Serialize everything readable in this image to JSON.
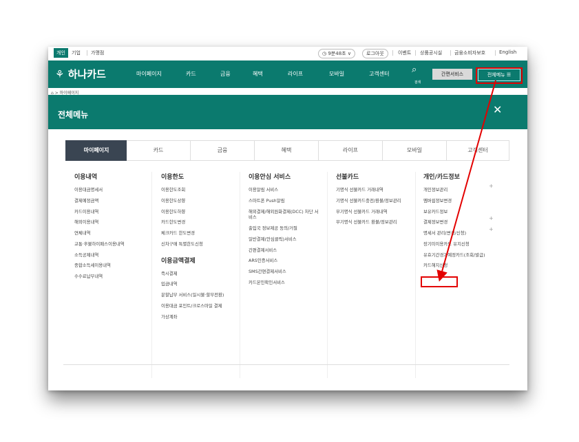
{
  "util": {
    "segments": [
      "개인",
      "기업",
      "가맹점"
    ],
    "timer": "9분48초",
    "logout": "로그아웃",
    "links": [
      "이벤트",
      "상품공시실",
      "금융소비자보호",
      "English"
    ]
  },
  "gnb": {
    "logo": "하나카드",
    "menus": [
      "마이페이지",
      "카드",
      "금융",
      "혜택",
      "라이프",
      "모바일",
      "고객센터"
    ],
    "bell_label": "검색",
    "simple_service": "간편서비스",
    "all_menu": "전체메뉴 ☰"
  },
  "breadcrumb": "⌂ > 마이페이지",
  "panel": {
    "title": "전체메뉴",
    "close": "✕"
  },
  "tabs": [
    "마이페이지",
    "카드",
    "금융",
    "혜택",
    "라이프",
    "모바일",
    "고객센터"
  ],
  "columns": {
    "c1": {
      "head": "이용내역",
      "items": [
        "이용대금명세서",
        "결제예정금액",
        "카드이용내역",
        "해외이용내역",
        "연체내역",
        "교통·후불하이패스이용내역",
        "소득공제내역",
        "종합소득세이용내역",
        "수수료납부내역"
      ]
    },
    "c2": {
      "head": "이용한도",
      "items": [
        "이용한도조회",
        "이용한도상향",
        "이용한도하향",
        "카드한도변경",
        "체크카드 한도변경",
        "신차구매 특별한도신청"
      ],
      "head2": "이용금액결제",
      "items2": [
        "즉시결제",
        "입금내역",
        "분할납부 서비스(일시불·할부전환)",
        "이용대금 포인트/크로스마일 결제",
        "가상계좌"
      ]
    },
    "c3": {
      "head": "이용안심 서비스",
      "items": [
        "이용알림 서비스",
        "스마트폰 Push알림",
        "해외결제/해외원화결제(DCC) 차단 서비스",
        "출입국 정보제공 동의/거절",
        "일반결제(안심클릭)서비스",
        "간편결제서비스",
        "ARS인증서비스",
        "SMS간편결제서비스",
        "카드본인확인서비스"
      ]
    },
    "c4": {
      "head": "선불카드",
      "items": [
        "기명식 선불카드 거래내역",
        "기명식 선불카드충전/환불/정보관리",
        "무기명식 선불카드 거래내역",
        "무기명식 선불카드 환불/정보관리"
      ]
    },
    "c5": {
      "head": "개인/카드정보",
      "items": [
        "개인정보관리",
        "멤버쉽정보변경",
        "보유카드정보",
        "결제정보변경",
        "명세서 관리(변경/신청)",
        "장기미이용카드 유지신청",
        "유효기간경과예정카드(조회/발급)",
        "카드해지신청"
      ]
    }
  },
  "colors": {
    "brand": "#0b7a6e",
    "tab_active": "#3a4552",
    "highlight": "#e30000"
  }
}
